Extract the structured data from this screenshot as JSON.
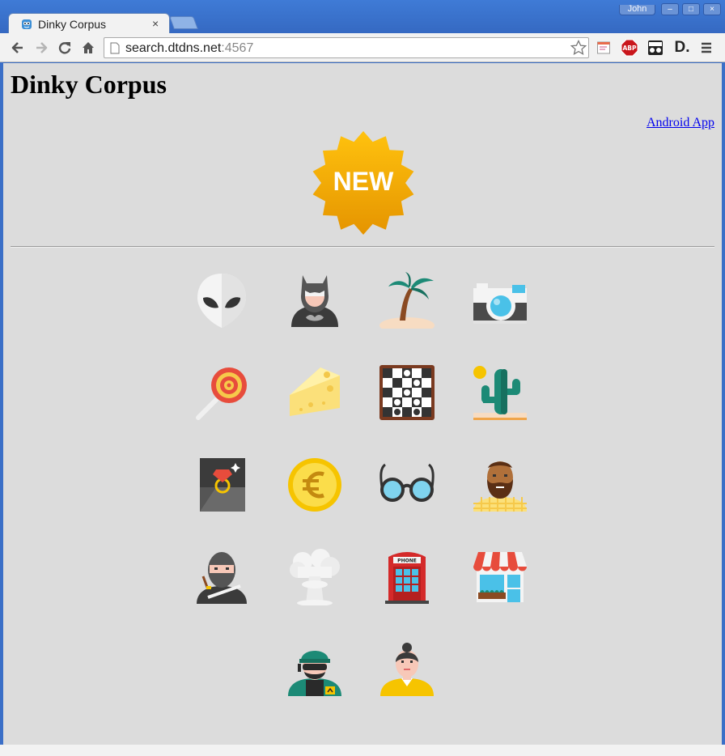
{
  "browser": {
    "tab": {
      "title": "Dinky Corpus",
      "close_glyph": "×"
    },
    "user": {
      "name": "John"
    },
    "window_controls": {
      "minimize": "–",
      "maximize": "□",
      "close": "×"
    },
    "url": {
      "host": "search.dtdns.net",
      "port": ":4567"
    },
    "toolbar_icons": [
      "back-icon",
      "forward-icon",
      "reload-icon",
      "home-icon",
      "page-icon",
      "bookmark-star-icon",
      "extension-notes-icon",
      "adblock-icon",
      "extension-glasses-icon",
      "extension-d-icon",
      "menu-icon"
    ],
    "adblock_label": "ABP",
    "d_label": "D."
  },
  "page": {
    "title": "Dinky Corpus",
    "android_link": "Android App",
    "new_badge_text": "NEW"
  },
  "icons": [
    {
      "name": "alien-icon"
    },
    {
      "name": "batman-icon"
    },
    {
      "name": "palm-island-icon"
    },
    {
      "name": "camera-icon"
    },
    {
      "name": "lollipop-icon"
    },
    {
      "name": "cheese-icon"
    },
    {
      "name": "checkerboard-icon"
    },
    {
      "name": "cactus-icon"
    },
    {
      "name": "ring-box-icon"
    },
    {
      "name": "euro-coin-icon"
    },
    {
      "name": "glasses-icon"
    },
    {
      "name": "bearded-man-icon"
    },
    {
      "name": "ninja-icon"
    },
    {
      "name": "mushroom-cloud-icon"
    },
    {
      "name": "phone-booth-icon"
    },
    {
      "name": "shop-icon"
    },
    {
      "name": "soldier-icon"
    },
    {
      "name": "woman-icon"
    }
  ],
  "phone_booth_label": "PHONE",
  "colors": {
    "tab_bar": "#3b6fc7",
    "page_background": "#dcdcdc",
    "link": "#0000ee",
    "badge_gold": "#f2a500"
  }
}
